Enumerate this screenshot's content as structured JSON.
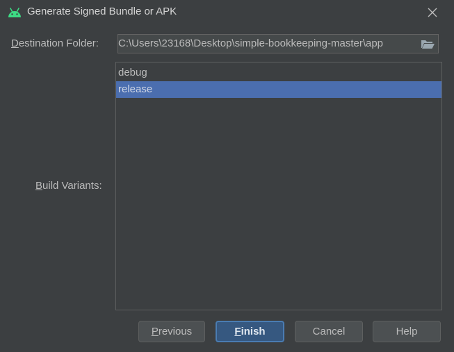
{
  "window": {
    "title": "Generate Signed Bundle or APK",
    "icon": "android-icon",
    "close_icon": "close-icon"
  },
  "form": {
    "destination": {
      "label_mnemonic": "D",
      "label_rest": "estination Folder:",
      "value": "C:\\Users\\23168\\Desktop\\simple-bookkeeping-master\\app",
      "browse_icon": "folder-icon"
    },
    "build_variants": {
      "label_mnemonic": "B",
      "label_rest": "uild Variants:",
      "items": [
        "debug",
        "release"
      ],
      "selected": "release"
    }
  },
  "buttons": {
    "previous": {
      "mnemonic": "P",
      "rest": "revious"
    },
    "finish": {
      "mnemonic": "F",
      "rest": "inish"
    },
    "cancel": "Cancel",
    "help": "Help"
  },
  "colors": {
    "background": "#3c3f41",
    "selection": "#4b6eaf",
    "android_green": "#3ddc84",
    "default_button": "#365880"
  }
}
